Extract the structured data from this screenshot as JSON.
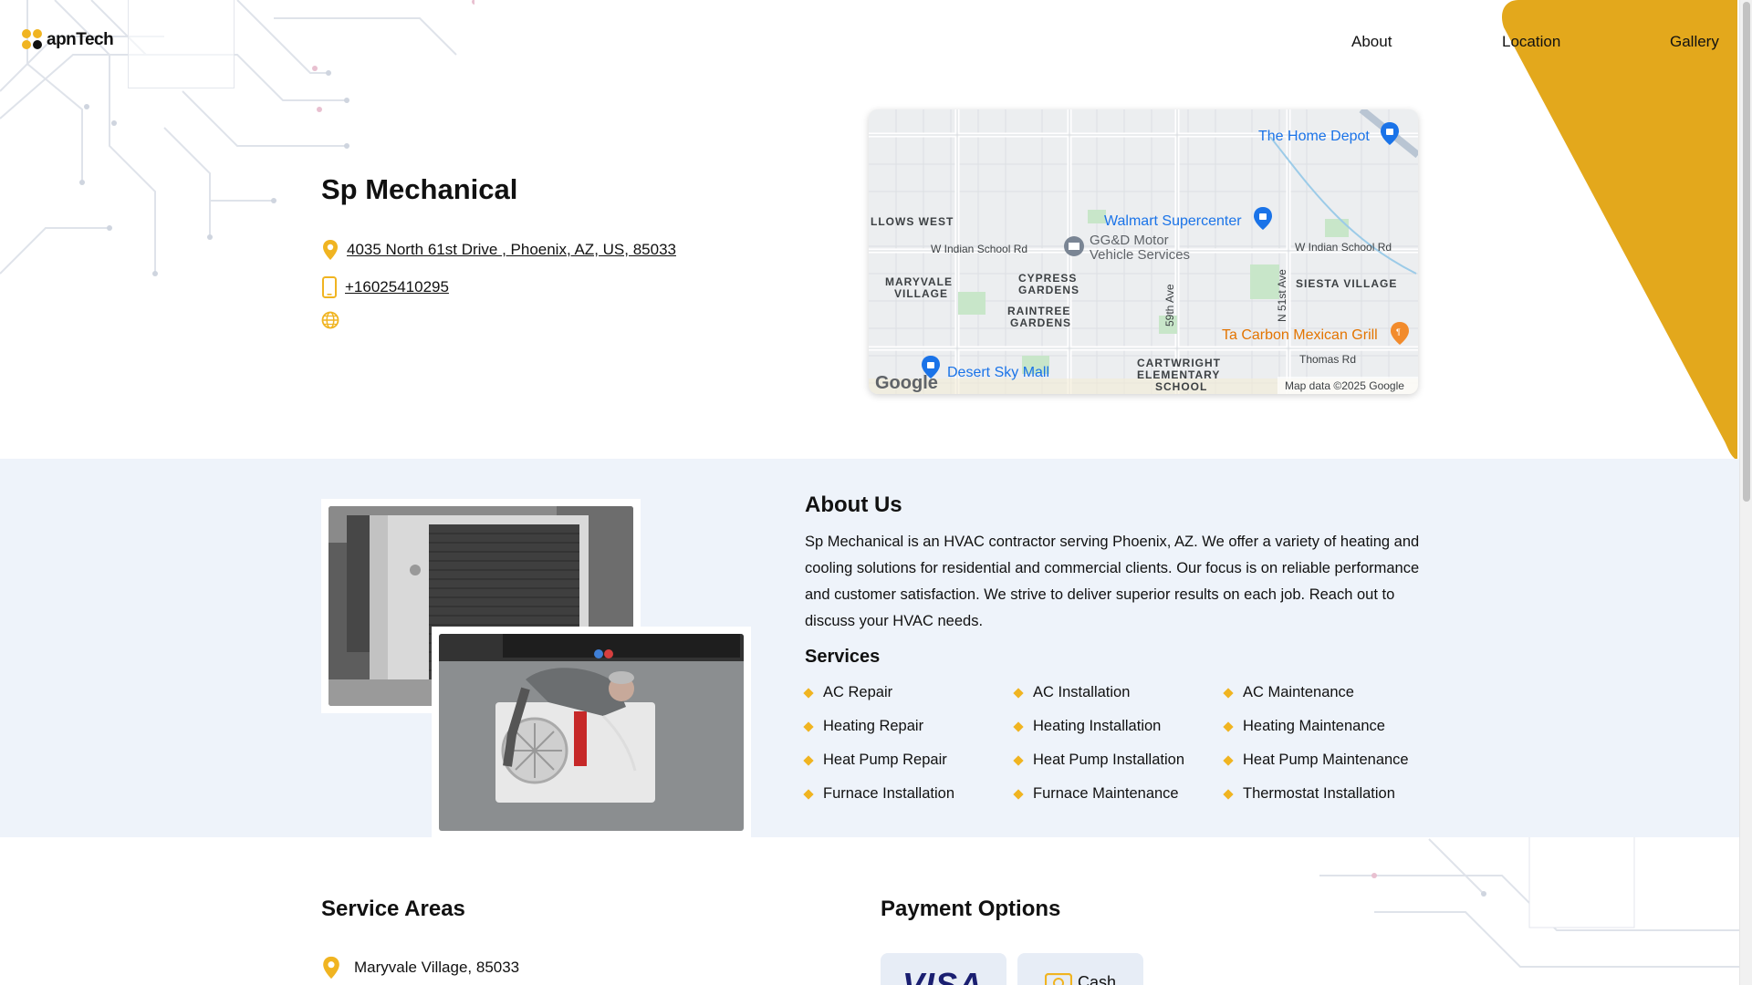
{
  "header": {
    "logo_text": "apnTech",
    "nav": [
      "About",
      "Location",
      "Gallery"
    ]
  },
  "business": {
    "name": "Sp Mechanical",
    "address": "4035 North 61st Drive , Phoenix, AZ, US, 85033",
    "phone": "+16025410295"
  },
  "map": {
    "labels": {
      "home_depot": "The Home Depot",
      "walmart": "Walmart Supercenter",
      "llows_west": "LLOWS WEST",
      "indian_school_1": "W Indian School Rd",
      "ggd_1": "GG&D Motor",
      "ggd_2": "Vehicle Services",
      "indian_school_2": "W Indian School Rd",
      "maryvale_1": "MARYVALE",
      "maryvale_2": "VILLAGE",
      "cypress_1": "CYPRESS",
      "cypress_2": "GARDENS",
      "raintree_1": "RAINTREE",
      "raintree_2": "GARDENS",
      "ave59": "59th Ave",
      "n51": "N 51st Ave",
      "siesta": "SIESTA VILLAGE",
      "ta_carbon": "Ta Carbon Mexican Grill",
      "thomas": "Thomas Rd",
      "cartwright_1": "CARTWRIGHT",
      "cartwright_2": "ELEMENTARY",
      "cartwright_3": "SCHOOL",
      "desert_sky": "Desert Sky Mall",
      "google": "Google",
      "map_data": "Map data ©2025 Google"
    }
  },
  "about": {
    "title": "About Us",
    "text": "Sp Mechanical is an HVAC contractor serving Phoenix, AZ. We offer a variety of heating and cooling solutions for residential and commercial clients. Our focus is on reliable performance and customer satisfaction. We strive to deliver superior results on each job. Reach out to discuss your HVAC needs.",
    "services_title": "Services",
    "services": [
      "AC Repair",
      "AC Installation",
      "AC Maintenance",
      "Heating Repair",
      "Heating Installation",
      "Heating Maintenance",
      "Heat Pump Repair",
      "Heat Pump Installation",
      "Heat Pump Maintenance",
      "Furnace Installation",
      "Furnace Maintenance",
      "Thermostat Installation"
    ]
  },
  "service_areas": {
    "title": "Service Areas",
    "items": [
      "Maryvale Village, 85033"
    ]
  },
  "payment": {
    "title": "Payment Options",
    "options": [
      "VISA",
      "Cash"
    ]
  },
  "colors": {
    "accent": "#f0b421",
    "section_bg": "#eef3fa"
  },
  "icons": [
    "location-pin-icon",
    "phone-icon",
    "globe-icon",
    "diamond-bullet-icon",
    "cash-icon"
  ]
}
